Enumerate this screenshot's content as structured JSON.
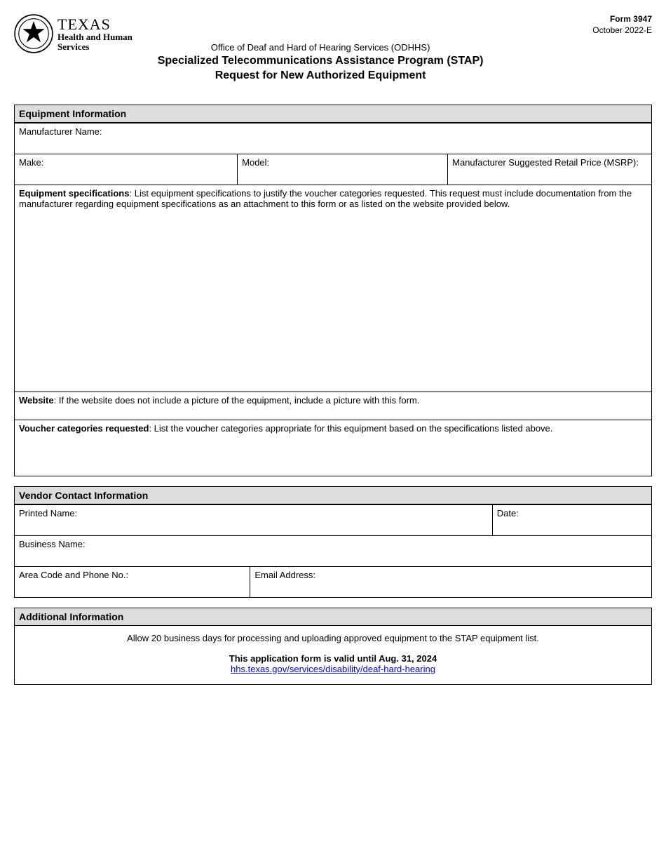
{
  "meta": {
    "form_no": "Form 3947",
    "revision": "October 2022-E"
  },
  "logo": {
    "texas": "TEXAS",
    "line1": "Health and Human",
    "line2": "Services"
  },
  "titles": {
    "office": "Office of Deaf and Hard of Hearing Services (ODHHS)",
    "program": "Specialized Telecommunications Assistance Program (STAP)",
    "subtitle": "Request for New Authorized Equipment"
  },
  "equipment": {
    "section": "Equipment Information",
    "manufacturer_label": "Manufacturer Name:",
    "make_label": "Make:",
    "model_label": "Model:",
    "msrp_label": "Manufacturer Suggested Retail Price (MSRP):",
    "spec_label": "Equipment specifications",
    "spec_text": ": List equipment specifications to justify the voucher categories requested. This request must include documentation from the manufacturer regarding equipment specifications as an attachment to this form or as listed on the website provided below.",
    "website_label": "Website",
    "website_text": ": If the website does not include a picture of the equipment, include a picture with this form.",
    "voucher_label": "Voucher categories requested",
    "voucher_text": ": List the voucher categories appropriate for this equipment based on the specifications listed above."
  },
  "vendor": {
    "section": "Vendor Contact Information",
    "printed_name": "Printed Name:",
    "date": "Date:",
    "business_name": "Business Name:",
    "phone": "Area Code and Phone No.:",
    "email": "Email Address:"
  },
  "additional": {
    "section": "Additional Information",
    "processing": "Allow 20 business days for processing and uploading approved equipment to the STAP equipment list.",
    "valid_until": "This application form is valid until Aug. 31, 2024",
    "link_text": "hhs.texas.gov/services/disability/deaf-hard-hearing"
  }
}
